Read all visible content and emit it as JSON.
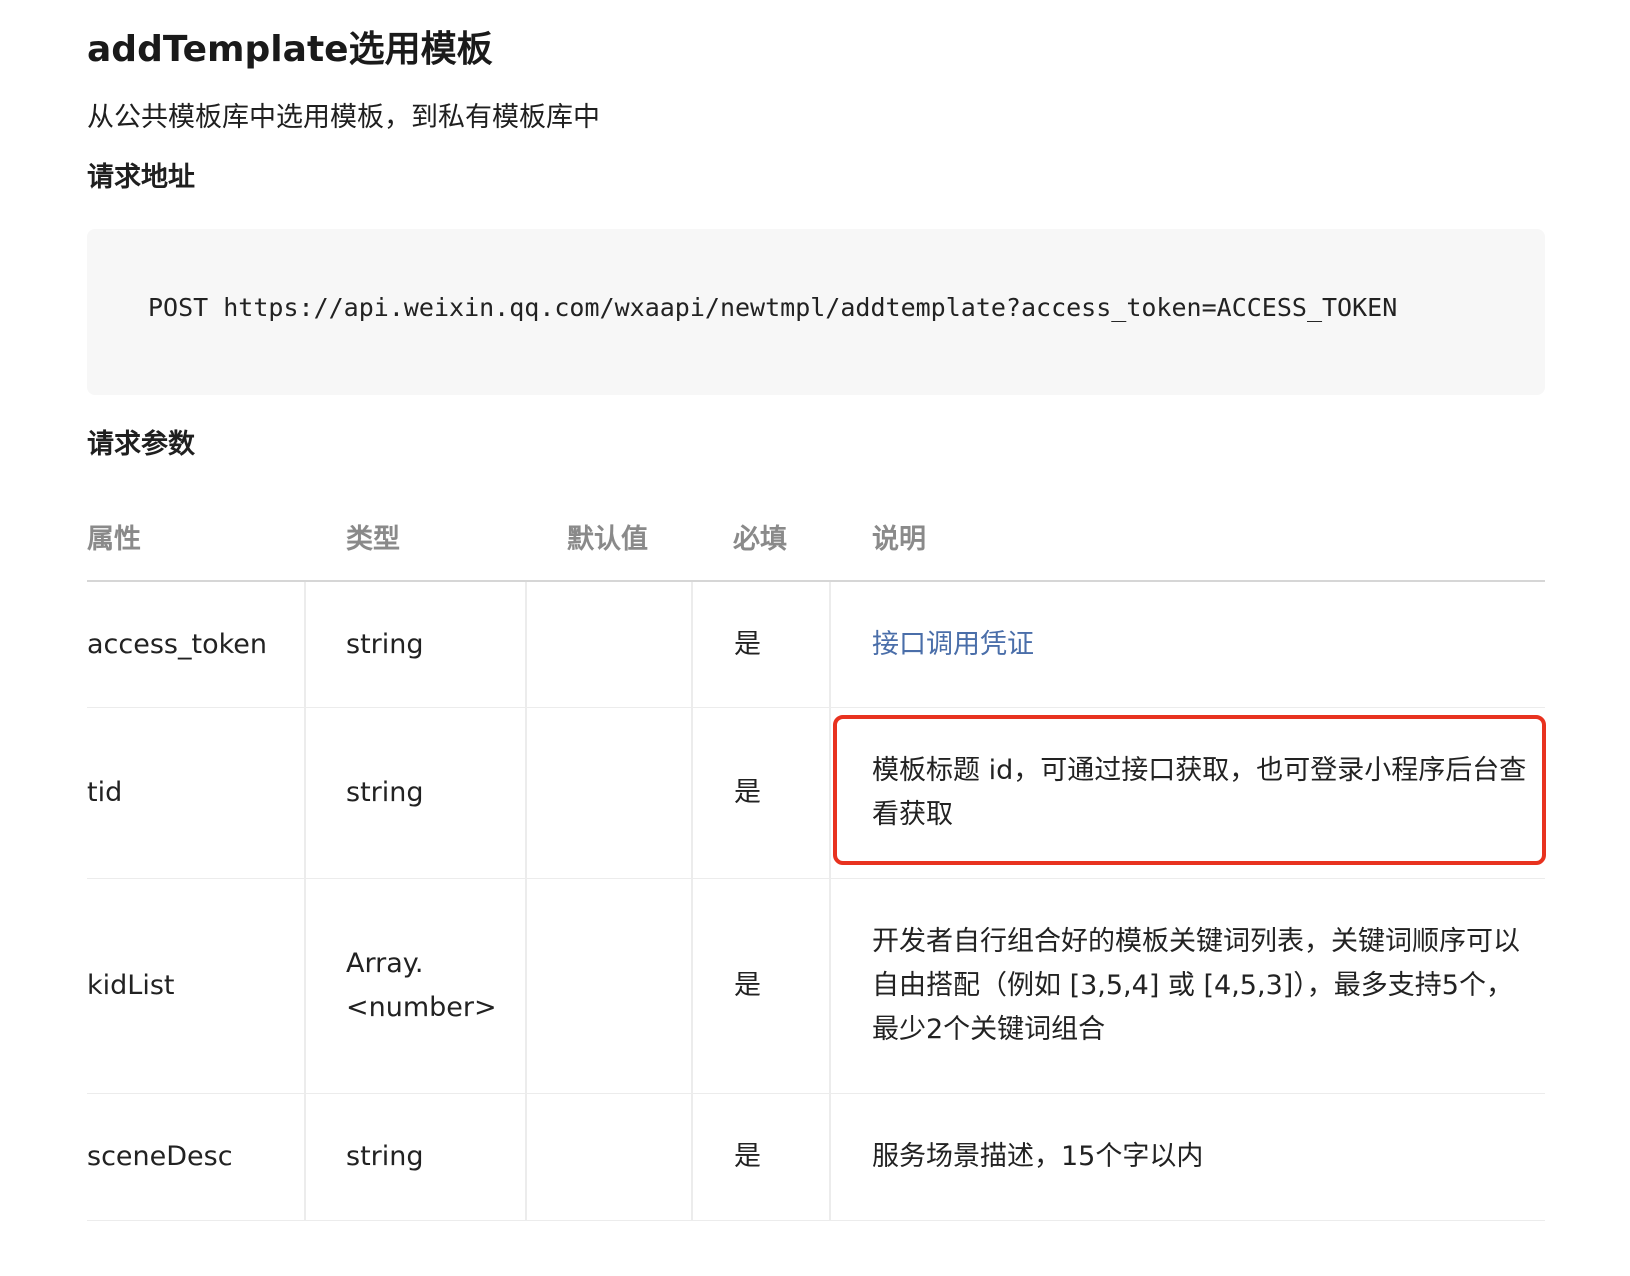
{
  "api": {
    "title": "addTemplate选用模板",
    "description": "从公共模板库中选用模板，到私有模板库中"
  },
  "request_address": {
    "heading": "请求地址",
    "code": "POST https://api.weixin.qq.com/wxaapi/newtmpl/addtemplate?access_token=ACCESS_TOKEN"
  },
  "request_params": {
    "heading": "请求参数",
    "columns": [
      "属性",
      "类型",
      "默认值",
      "必填",
      "说明"
    ],
    "rows": [
      {
        "name": "access_token",
        "type": "string",
        "default": "",
        "required": "是",
        "description": "接口调用凭证",
        "description_is_link": true
      },
      {
        "name": "tid",
        "type": "string",
        "default": "",
        "required": "是",
        "description": "模板标题 id，可通过接口获取，也可登录小程序后台查看获取",
        "highlighted": true
      },
      {
        "name": "kidList",
        "type": "Array.\n<number>",
        "default": "",
        "required": "是",
        "description": "开发者自行组合好的模板关键词列表，关键词顺序可以自由搭配（例如 [3,5,4] 或 [4,5,3]），最多支持5个，最少2个关键词组合"
      },
      {
        "name": "sceneDesc",
        "type": "string",
        "default": "",
        "required": "是",
        "description": "服务场景描述，15个字以内"
      }
    ]
  },
  "colors": {
    "highlight_border": "#e8321f",
    "link": "#4a6ea9",
    "header_text": "#8a8a8a",
    "code_background": "#f7f7f7"
  }
}
